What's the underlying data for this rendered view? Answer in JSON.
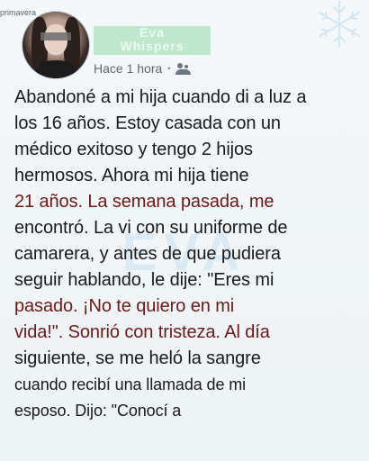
{
  "top_tag": "primavera",
  "author": {
    "name_line_1": "Eva",
    "name_line_2": "Whispers"
  },
  "meta": {
    "time": "Hace 1 hora",
    "separator": "•",
    "audience_icon": "friends-icon"
  },
  "watermark": "EVA",
  "story": {
    "lines": [
      "Abandoné a mi hija cuando di a luz a",
      "los 16 años. Estoy casada con un",
      "médico exitoso y tengo 2 hijos",
      "hermosos. Ahora mi hija tiene",
      "21 años. La semana pasada, me",
      "encontró. La vi con su uniforme de",
      "camarera, y antes de que pudiera",
      "seguir hablando, le dije: \"Eres mi",
      "pasado. ¡No te quiero en mi",
      "vida!\". Sonrió con tristeza. Al día",
      "siguiente, se me heló la sangre",
      "cuando recibí una llamada de mi",
      "esposo. Dijo: \"Conocí a"
    ]
  },
  "colors": {
    "text": "#1a1a1a",
    "emphasis_text": "#6b1a18",
    "name_highlight": "#bfe8ce",
    "background": "#eef4f8"
  }
}
